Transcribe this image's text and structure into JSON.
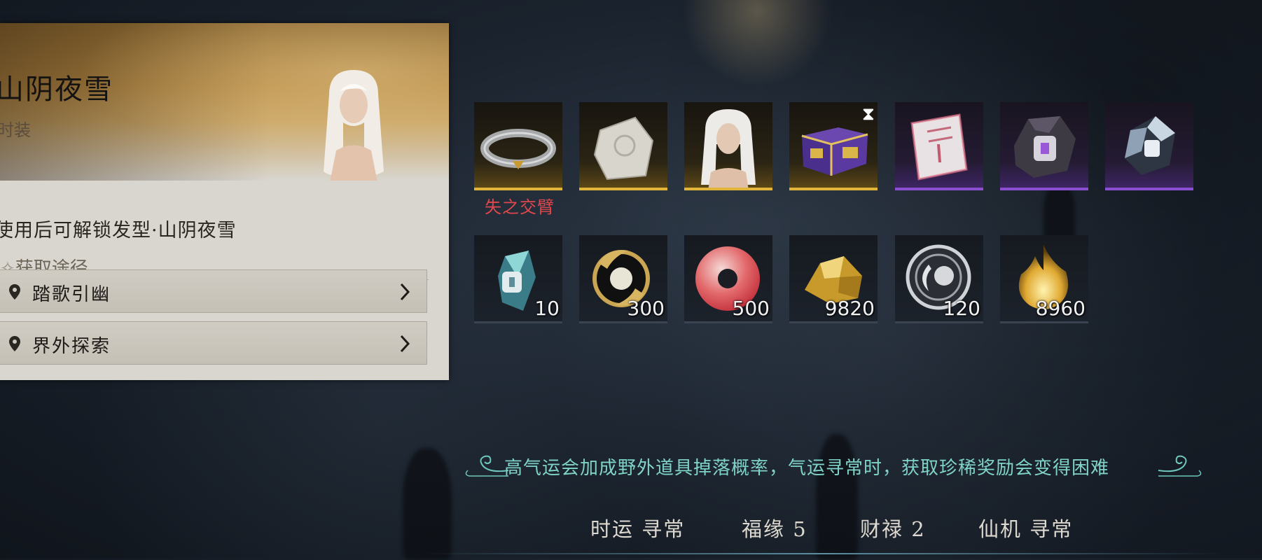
{
  "item": {
    "title": "山阴夜雪",
    "type": "时装",
    "description": "使用后可解锁发型·山阴夜雪",
    "source_label": "获取途径",
    "sources": [
      {
        "label": "踏歌引幽"
      },
      {
        "label": "界外探索"
      }
    ]
  },
  "rewards": {
    "row1": [
      {
        "icon": "bracelet-icon",
        "rarity": "gold",
        "caption": "失之交臂"
      },
      {
        "icon": "stone-tablet-icon",
        "rarity": "gold"
      },
      {
        "icon": "portrait-icon",
        "rarity": "gold"
      },
      {
        "icon": "treasure-chest-icon",
        "rarity": "gold",
        "badge": "⧗"
      },
      {
        "icon": "scroll-icon",
        "rarity": "purple"
      },
      {
        "icon": "ore-icon",
        "rarity": "purple"
      },
      {
        "icon": "crystal-icon",
        "rarity": "purple"
      }
    ],
    "row2": [
      {
        "icon": "crystal-shard-icon",
        "count": "10"
      },
      {
        "icon": "jade-pendant-icon",
        "count": "300"
      },
      {
        "icon": "red-jade-disc-icon",
        "count": "500"
      },
      {
        "icon": "gold-nugget-icon",
        "count": "9820"
      },
      {
        "icon": "silver-coin-icon",
        "count": "120"
      },
      {
        "icon": "golden-flame-icon",
        "count": "8960"
      }
    ]
  },
  "luck": {
    "banner": "高气运会加成野外道具掉落概率，气运寻常时，获取珍稀奖励会变得困难",
    "stats": [
      "时运 寻常",
      "福缘 5",
      "财禄 2",
      "仙机 寻常"
    ]
  },
  "colors": {
    "gold_rarity": "#e0b53a",
    "purple_rarity": "#8a4fd0",
    "missed_text": "#e0474d",
    "banner_text": "#7fd3c9"
  }
}
